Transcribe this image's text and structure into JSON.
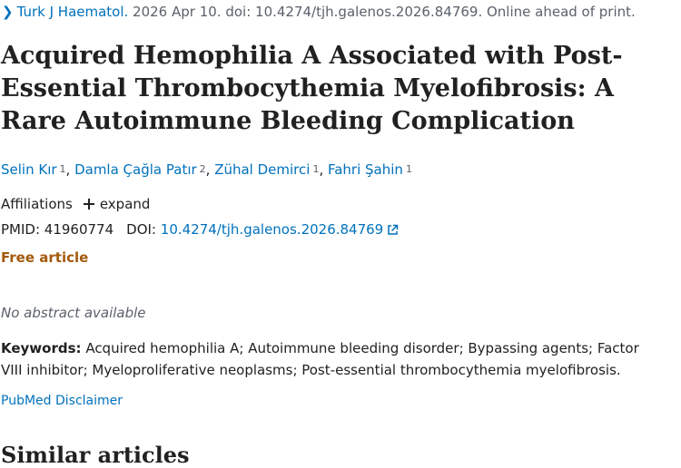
{
  "citation": {
    "journal": "Turk J Haematol.",
    "details": " 2026 Apr 10. doi: 10.4274/tjh.galenos.2026.84769. Online ahead of print."
  },
  "article": {
    "title": "Acquired Hemophilia A Associated with Post-Essential Thrombocythemia Myelofibrosis: A Rare Autoimmune Bleeding Complication"
  },
  "authors": [
    {
      "name": "Selin Kır",
      "aff": "1"
    },
    {
      "name": "Damla Çağla Patır",
      "aff": "2"
    },
    {
      "name": "Zühal Demirci",
      "aff": "1"
    },
    {
      "name": "Fahri Şahin",
      "aff": "1"
    }
  ],
  "affiliations": {
    "label": "Affiliations",
    "expand_label": "expand"
  },
  "identifiers": {
    "pmid_label": "PMID:",
    "pmid": "41960774",
    "doi_label": "DOI:",
    "doi": "10.4274/tjh.galenos.2026.84769"
  },
  "free_article": "Free article",
  "abstract": {
    "none": "No abstract available"
  },
  "keywords": {
    "label": "Keywords:",
    "text": " Acquired hemophilia A; Autoimmune bleeding disorder; Bypassing agents; Factor VIII inhibitor; Myeloproliferative neoplasms; Post-essential thrombocythemia myelofibrosis."
  },
  "disclaimer": "PubMed Disclaimer",
  "similar_heading": "Similar articles",
  "icons": {
    "chevron": "chevron-right-icon",
    "plus": "plus-icon",
    "external": "external-link-icon"
  },
  "colors": {
    "link": "#0071bc",
    "free_article": "#a4590b",
    "text": "#212121"
  }
}
